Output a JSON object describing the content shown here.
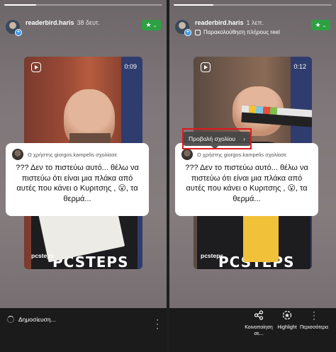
{
  "left": {
    "username": "readerbird.haris",
    "time": "38 δευτ.",
    "progress_fraction": 0.2,
    "video": {
      "duration": "0:09",
      "author": "pcsteps",
      "shirt_text": "PCSTEPS"
    },
    "comment": {
      "header": "Ο χρήστης giorgos.kampelis σχολίασε",
      "text": "??? Δεν το πιστεύω αυτό... θέλω να πιστεύω ότι είναι μια πλάκα από αυτές που κάνει ο Κυριτσης , 😮, τα θερμά..."
    },
    "bottom": {
      "status": "Δημοσίευση..."
    }
  },
  "right": {
    "username": "readerbird.haris",
    "time": "1 λεπ.",
    "subtitle": "Παρακολούθηση πλήρους reel",
    "progress_fraction": 0.25,
    "video": {
      "duration": "0:12",
      "author": "pcsteps",
      "shirt_text": "PCSTEPS"
    },
    "tooltip": {
      "label": "Προβολή σχολίου",
      "chevron": "›"
    },
    "comment": {
      "header": "Ο χρήστης giorgos.kampelis σχολίασε",
      "text": "??? Δεν το πιστεύω αυτό... θέλω να πιστεύω ότι είναι μια πλάκα από αυτές που κάνει ο Κυριτσης , 😮, τα θερμά..."
    },
    "actions": [
      {
        "label": "Κοινοποίηση σε...",
        "icon": "share-icon"
      },
      {
        "label": "Highlight",
        "icon": "highlight-icon"
      },
      {
        "label": "Περισσότερα",
        "icon": "more-icon"
      }
    ]
  },
  "favorite_star": "★",
  "favorite_chevron": "⌄",
  "colors": {
    "favorite": "#2ea043",
    "verified": "#3897f0",
    "highlight_border": "#e0191f"
  }
}
